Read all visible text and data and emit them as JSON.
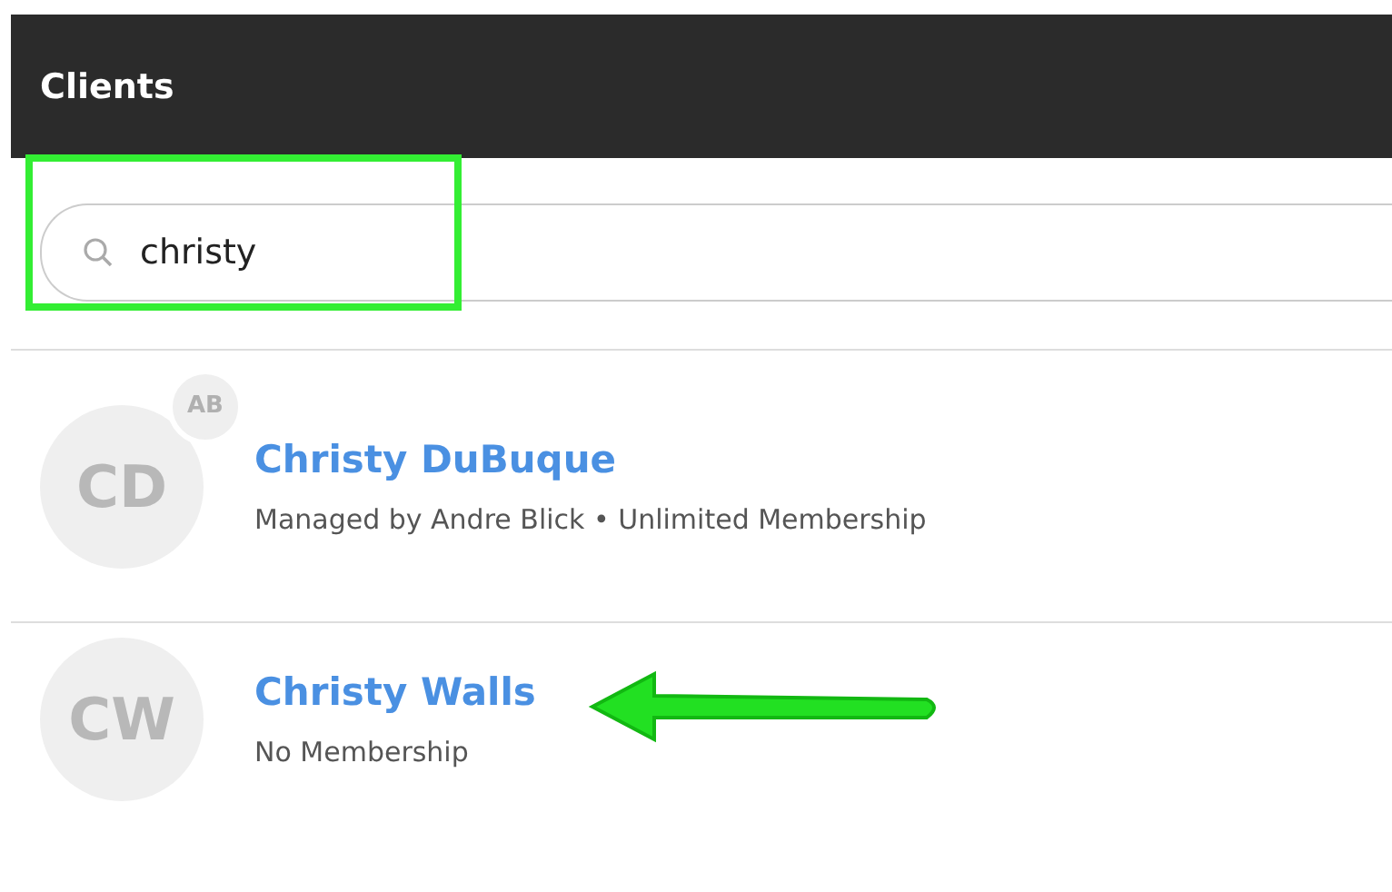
{
  "header": {
    "title": "Clients"
  },
  "search": {
    "value": "christy"
  },
  "clients": [
    {
      "initials": "CD",
      "badge": "AB",
      "name": "Christy DuBuque",
      "detail": "Managed by Andre Blick • Unlimited Membership"
    },
    {
      "initials": "CW",
      "name": "Christy Walls",
      "detail": "No Membership"
    }
  ]
}
